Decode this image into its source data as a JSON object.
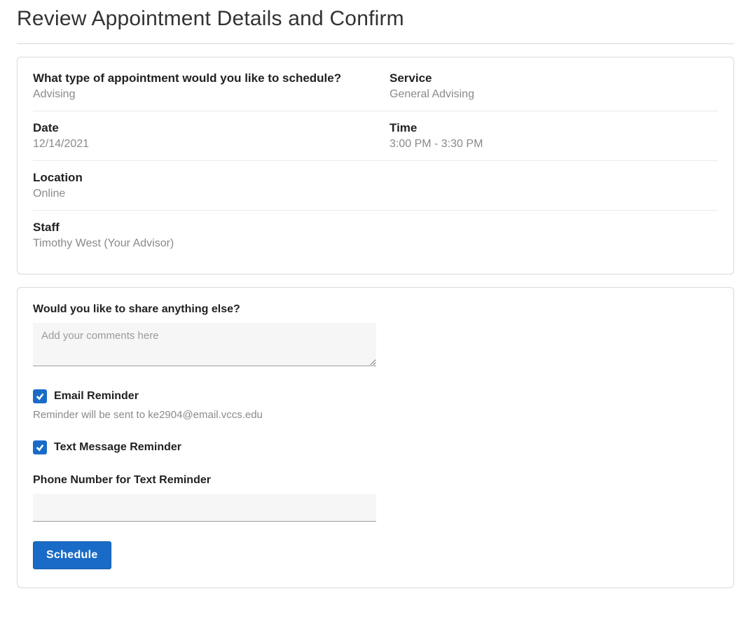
{
  "title": "Review Appointment Details and Confirm",
  "summary": {
    "appt_type_label": "What type of appointment would you like to schedule?",
    "appt_type_value": "Advising",
    "service_label": "Service",
    "service_value": "General Advising",
    "date_label": "Date",
    "date_value": "12/14/2021",
    "time_label": "Time",
    "time_value": "3:00 PM - 3:30 PM",
    "location_label": "Location",
    "location_value": "Online",
    "staff_label": "Staff",
    "staff_value": "Timothy West (Your Advisor)"
  },
  "form": {
    "comments_label": "Would you like to share anything else?",
    "comments_placeholder": "Add your comments here",
    "comments_value": "",
    "email_reminder_label": "Email Reminder",
    "email_reminder_checked": true,
    "email_reminder_helper": "Reminder will be sent to ke2904@email.vccs.edu",
    "text_reminder_label": "Text Message Reminder",
    "text_reminder_checked": true,
    "phone_label": "Phone Number for Text Reminder",
    "phone_value": "",
    "schedule_label": "Schedule"
  }
}
